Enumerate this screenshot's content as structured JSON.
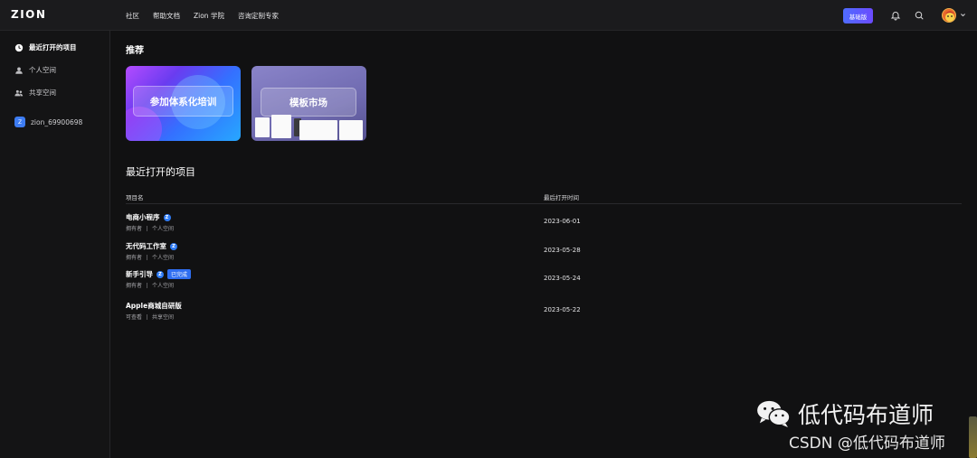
{
  "header": {
    "logo": "ZION",
    "nav": [
      "社区",
      "帮助文档",
      "Zion 学院",
      "咨询定制专家"
    ],
    "plan_label": "基础版"
  },
  "sidebar": {
    "items": [
      {
        "label": "最近打开的项目",
        "icon": "clock-icon",
        "active": true
      },
      {
        "label": "个人空间",
        "icon": "user-icon",
        "active": false
      },
      {
        "label": "共享空间",
        "icon": "users-icon",
        "active": false
      }
    ],
    "workspace": {
      "badge": "Z",
      "label": "zion_69900698"
    }
  },
  "recommend": {
    "title": "推荐",
    "cards": [
      {
        "label": "参加体系化培训"
      },
      {
        "label": "模板市场"
      }
    ]
  },
  "recent": {
    "title": "最近打开的项目",
    "columns": {
      "name": "项目名",
      "time": "最后打开时间"
    },
    "rows": [
      {
        "name": "电商小程序",
        "has_icon": true,
        "tag": "",
        "role": "拥有者",
        "space": "个人空间",
        "date": "2023-06-01"
      },
      {
        "name": "无代码工作室",
        "has_icon": true,
        "tag": "",
        "role": "拥有者",
        "space": "个人空间",
        "date": "2023-05-28"
      },
      {
        "name": "新手引导",
        "has_icon": true,
        "tag": "已完成",
        "role": "拥有者",
        "space": "个人空间",
        "date": "2023-05-24"
      },
      {
        "name": "Apple商城自研版",
        "has_icon": false,
        "tag": "",
        "role": "可查看",
        "space": "共享空间",
        "date": "2023-05-22"
      }
    ],
    "z_icon_glyph": "Z"
  },
  "watermark": {
    "line1": "低代码布道师",
    "line2": "CSDN @低代码布道师"
  },
  "colors": {
    "background": "#111112",
    "accent": "#2f7cf6",
    "plan_button": "#5b5cff"
  }
}
